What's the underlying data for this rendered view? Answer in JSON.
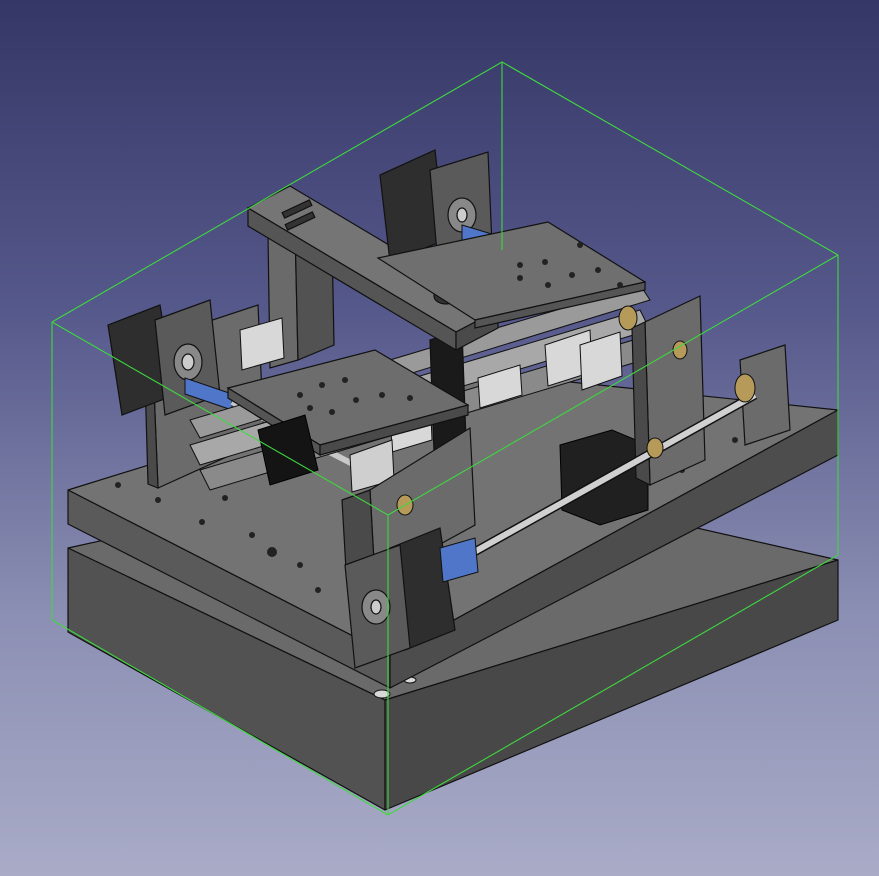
{
  "viewport": {
    "background_top": "#353766",
    "background_bottom": "#a9abc7",
    "bounding_box_color": "#3fd83f",
    "edge_color": "#111111"
  },
  "model": {
    "description_hidden": "",
    "colors": {
      "plate_top": "#6c6c6c",
      "plate_front": "#555555",
      "plate_side": "#474747",
      "motor_body": "#2f2f2f",
      "motor_face": "#5a5a5a",
      "coupler": "#4f76c8",
      "lead_screw": "#c8c8c8",
      "nut_brass": "#b59a5a",
      "bearing_block": "#d8d8d8",
      "rail": "#9a9a9a",
      "black_block": "#141414"
    },
    "icons": [
      "stepper-motor-icon",
      "coupler-icon",
      "lead-screw-icon",
      "linear-rail-icon"
    ]
  }
}
